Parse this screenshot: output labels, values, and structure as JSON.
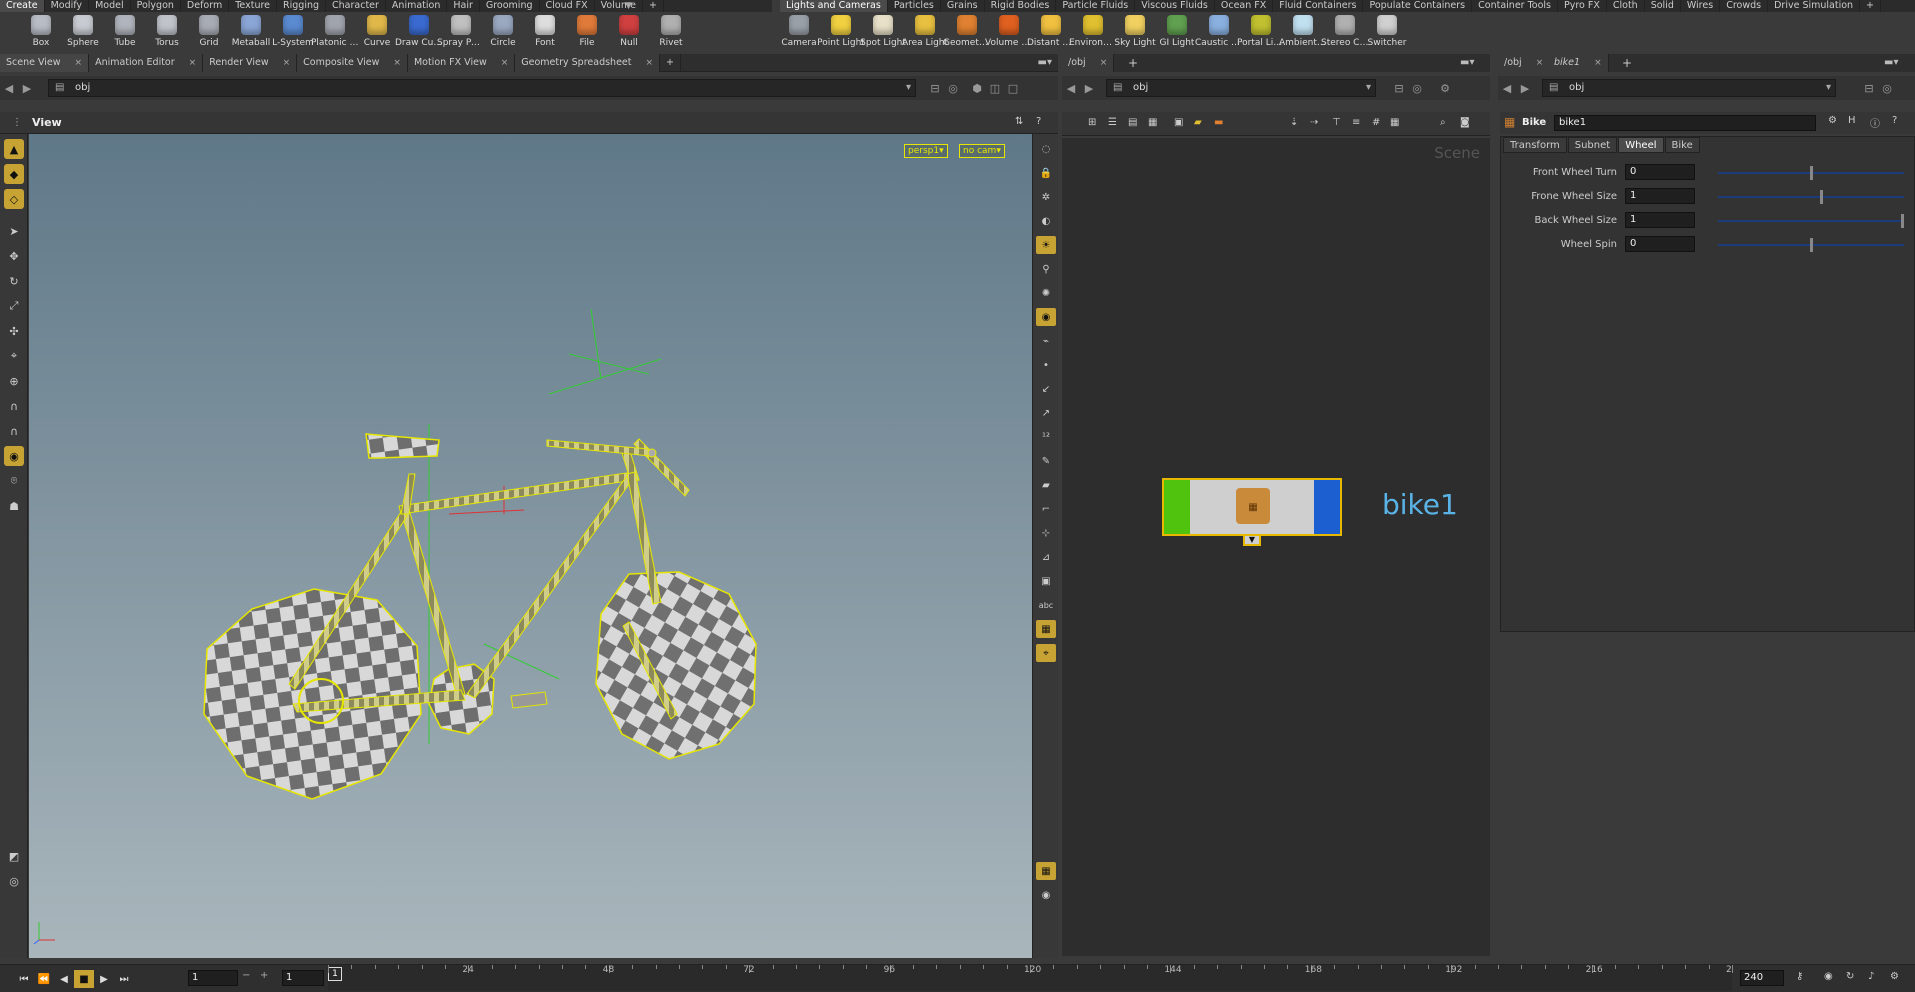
{
  "shelf_left": {
    "tabs": [
      "Create",
      "Modify",
      "Model",
      "Polygon",
      "Deform",
      "Texture",
      "Rigging",
      "Character",
      "Animation",
      "Hair",
      "Grooming",
      "Cloud FX",
      "Volume"
    ],
    "tools": [
      {
        "label": "Box",
        "icon": "box-icon",
        "color": "#b8bcc4"
      },
      {
        "label": "Sphere",
        "icon": "sphere-icon",
        "color": "#c8ccd2"
      },
      {
        "label": "Tube",
        "icon": "tube-icon",
        "color": "#b0b4bc"
      },
      {
        "label": "Torus",
        "icon": "torus-icon",
        "color": "#c0c4ca"
      },
      {
        "label": "Grid",
        "icon": "grid-icon",
        "color": "#a8acb4"
      },
      {
        "label": "Metaball",
        "icon": "metaball-icon",
        "color": "#8aa6d6"
      },
      {
        "label": "L-System",
        "icon": "lsystem-icon",
        "color": "#5a8ad0"
      },
      {
        "label": "Platonic Sol...",
        "icon": "platonic-icon",
        "color": "#a0a4ac"
      },
      {
        "label": "Curve",
        "icon": "curve-icon",
        "color": "#e0b84a"
      },
      {
        "label": "Draw Curve",
        "icon": "draw-curve-icon",
        "color": "#3a6ad0"
      },
      {
        "label": "Spray Paint",
        "icon": "spray-paint-icon",
        "color": "#c0c0c0"
      },
      {
        "label": "Circle",
        "icon": "circle-icon",
        "color": "#9aa8c0"
      },
      {
        "label": "Font",
        "icon": "font-icon",
        "color": "#dddddd"
      },
      {
        "label": "File",
        "icon": "file-icon",
        "color": "#e07a3a"
      },
      {
        "label": "Null",
        "icon": "null-icon",
        "color": "#d04040"
      },
      {
        "label": "Rivet",
        "icon": "rivet-icon",
        "color": "#b0b0b0"
      }
    ]
  },
  "shelf_right": {
    "tabs": [
      "Lights and Cameras",
      "Particles",
      "Grains",
      "Rigid Bodies",
      "Particle Fluids",
      "Viscous Fluids",
      "Ocean FX",
      "Fluid Containers",
      "Populate Containers",
      "Container Tools",
      "Pyro FX",
      "Cloth",
      "Solid",
      "Wires",
      "Crowds",
      "Drive Simulation"
    ],
    "tools": [
      {
        "label": "Camera",
        "icon": "camera-icon",
        "color": "#9aa0a8"
      },
      {
        "label": "Point Light",
        "icon": "point-light-icon",
        "color": "#f0d040"
      },
      {
        "label": "Spot Light",
        "icon": "spot-light-icon",
        "color": "#e8e0c8"
      },
      {
        "label": "Area Light",
        "icon": "area-light-icon",
        "color": "#e8c040"
      },
      {
        "label": "Geometry L...",
        "icon": "geometry-light-icon",
        "color": "#e08030"
      },
      {
        "label": "Volume Light",
        "icon": "volume-light-icon",
        "color": "#e06020"
      },
      {
        "label": "Distant Light",
        "icon": "distant-light-icon",
        "color": "#f0c040"
      },
      {
        "label": "Environmen...",
        "icon": "environment-light-icon",
        "color": "#e0c030"
      },
      {
        "label": "Sky Light",
        "icon": "sky-light-icon",
        "color": "#f0d060"
      },
      {
        "label": "GI Light",
        "icon": "gi-light-icon",
        "color": "#60a050"
      },
      {
        "label": "Caustic Light",
        "icon": "caustic-light-icon",
        "color": "#8ab0e0"
      },
      {
        "label": "Portal Light",
        "icon": "portal-light-icon",
        "color": "#c0c030"
      },
      {
        "label": "Ambient Lig...",
        "icon": "ambient-light-icon",
        "color": "#c0e0f0"
      },
      {
        "label": "Stereo Cam...",
        "icon": "stereo-camera-icon",
        "color": "#b0b0b0"
      },
      {
        "label": "Switcher",
        "icon": "switcher-icon",
        "color": "#d0d0d0"
      }
    ]
  },
  "left_pane": {
    "tabs": [
      "Scene View",
      "Animation Editor",
      "Render View",
      "Composite View",
      "Motion FX View",
      "Geometry Spreadsheet"
    ],
    "path": "obj",
    "view_label": "View",
    "camera_menu": "persp1",
    "cam_menu": "no cam"
  },
  "network_pane": {
    "tab": "/obj",
    "path": "obj",
    "watermark": "Scene",
    "node_name": "bike1"
  },
  "parm_pane": {
    "tabs": [
      "/obj",
      "bike1"
    ],
    "path": "obj",
    "type_label": "Bike",
    "node_name": "bike1",
    "folders": [
      "Transform",
      "Subnet",
      "Wheel",
      "Bike"
    ],
    "active_folder": "Wheel",
    "parms": [
      {
        "label": "Front Wheel Turn",
        "value": "0",
        "slider": 0.5
      },
      {
        "label": "Frone Wheel Size",
        "value": "1",
        "slider": 0.56
      },
      {
        "label": "Back Wheel Size",
        "value": "1",
        "slider": 1.0
      },
      {
        "label": "Wheel Spin",
        "value": "0",
        "slider": 0.5
      }
    ]
  },
  "timeline": {
    "current_frame": "1",
    "start_frame": "1",
    "frame_marker": "1",
    "end_frame": "240",
    "ticks": [
      "24",
      "48",
      "72",
      "96",
      "120",
      "144",
      "168",
      "192",
      "216",
      "2"
    ]
  }
}
